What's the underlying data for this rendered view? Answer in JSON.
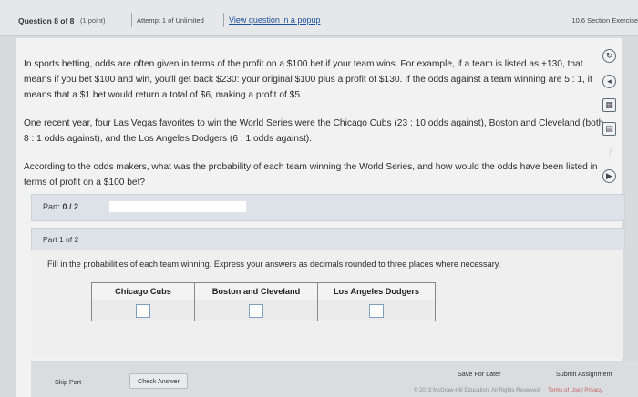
{
  "header": {
    "question": "Question 8 of 8",
    "points": "(1 point)",
    "attempt": "Attempt 1 of Unlimited",
    "popup_link": "View question in a popup",
    "section": "10.6 Section Exercise"
  },
  "problem": {
    "paragraph1": "In sports betting, odds are often given in terms of the profit on a $100 bet if your team wins. For example, if a team is listed as +130, that means if you bet $100 and win, you'll get back $230: your original $100 plus a profit of $130. If the odds against a team winning are 5 : 1, it means that a $1 bet would return a total of $6, making a profit of $5.",
    "paragraph2": "One recent year, four Las Vegas favorites to win the World Series were the Chicago Cubs (23 : 10 odds against), Boston and Cleveland (both 8 : 1 odds against), and the Los Angeles Dodgers (6 : 1 odds against).",
    "paragraph3": "According to the odds makers, what was the probability of each team winning the World Series, and how would the odds have been listed in terms of profit on a $100 bet?"
  },
  "parts": {
    "label": "Part:",
    "progress": "0 / 2",
    "current_part": "Part 1 of 2"
  },
  "instructions": "Fill in the probabilities of each team winning. Express your answers as decimals rounded to three places where necessary.",
  "table": {
    "headers": [
      "Chicago Cubs",
      "Boston and Cleveland",
      "Los Angeles Dodgers"
    ]
  },
  "actions": {
    "skip": "Skip Part",
    "check": "Check Answer",
    "save": "Save For Later",
    "submit": "Submit Assignment"
  },
  "footer": {
    "copyright": "© 2019 McGraw-Hill Education. All Rights Reserved.",
    "terms": "Terms of Use",
    "privacy": "Privacy"
  },
  "tools": [
    "ask-icon",
    "book-icon",
    "calculator-icon",
    "print-icon",
    "help-icon",
    "media-icon"
  ]
}
